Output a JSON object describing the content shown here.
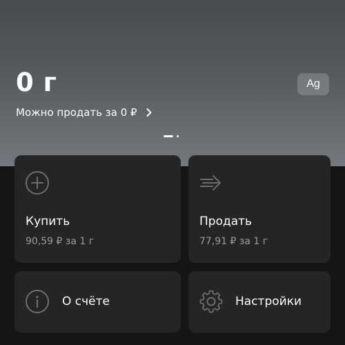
{
  "header": {
    "balance": "0 г",
    "metal_badge": "Ag",
    "sell_hint": "Можно продать за 0 ₽",
    "chevron_icon": "chevron-right-icon"
  },
  "actions": {
    "buy": {
      "icon": "plus-circle-icon",
      "title": "Купить",
      "price": "90,59 ₽ за 1 г"
    },
    "sell": {
      "icon": "arrow-right-fast-icon",
      "title": "Продать",
      "price": "77,91 ₽ за 1 г"
    },
    "account_info": {
      "icon": "info-circle-icon",
      "label": "О счёте"
    },
    "settings": {
      "icon": "gear-icon",
      "label": "Настройки"
    }
  },
  "pager": {
    "pages": 2,
    "active": 1
  },
  "colors": {
    "background": "#151515",
    "card": "#252525",
    "secondary_text": "#9c9c9c",
    "icon_stroke": "#6e6e6e"
  }
}
